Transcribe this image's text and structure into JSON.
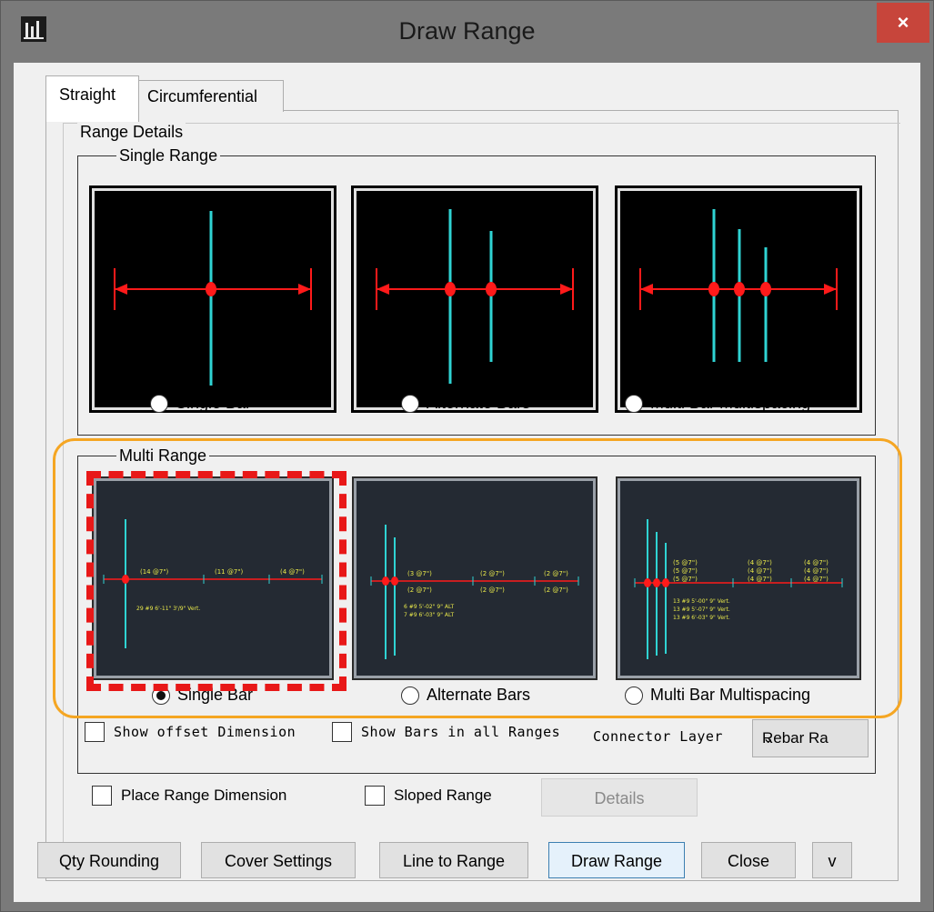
{
  "window": {
    "title": "Draw Range",
    "close_label": "×"
  },
  "tabs": {
    "straight": "Straight",
    "circumferential": "Circumferential"
  },
  "range_details": {
    "label": "Range Details",
    "single_range": {
      "label": "Single Range",
      "options": [
        "Single Bar",
        "Alternate Bars",
        "Multi Bar Multispacing"
      ]
    },
    "multi_range": {
      "label": "Multi Range",
      "options": [
        "Single Bar",
        "Alternate Bars",
        "Multi Bar Multispacing"
      ],
      "selected": "Single Bar",
      "thumb1": {
        "labels": [
          "(14 @7\")",
          "(11 @7\")",
          "(4 @7\")"
        ],
        "note": "29 #9 6'-11\" 3'/9\" Vert."
      },
      "thumb2": {
        "labels_top": [
          "(3 @7\")",
          "(2 @7\")",
          "(2 @7\")"
        ],
        "labels_bot": [
          "(2 @7\")",
          "(2 @7\")",
          "(2 @7\")"
        ],
        "notes": [
          "6 #9 5'-02\" 9\" ALT",
          "7 #9 6'-03\" 9\" ALT"
        ]
      },
      "thumb3": {
        "col1": [
          "(5 @7\")",
          "(5 @7\")",
          "(5 @7\")"
        ],
        "col2": [
          "(4 @7\")",
          "(4 @7\")",
          "(4 @7\")"
        ],
        "col3": [
          "(4 @7\")",
          "(4 @7\")",
          "(4 @7\")"
        ],
        "notes": [
          "13 #9 5'-00\" 9\" Vert.",
          "13 #9 5'-07\" 9\" Vert.",
          "13 #9 6'-03\" 9\" Vert."
        ]
      }
    },
    "show_offset_dimension": "Show offset Dimension",
    "show_bars_in_all_ranges": "Show Bars in all Ranges",
    "connector_layer_label": "Connector Layer",
    "connector_layer_value": "Rebar Ra",
    "place_range_dimension": "Place Range Dimension",
    "sloped_range": "Sloped Range",
    "details_button": "Details"
  },
  "buttons": {
    "qty_rounding": "Qty Rounding",
    "cover_settings": "Cover Settings",
    "line_to_range": "Line to Range",
    "draw_range": "Draw Range",
    "close": "Close",
    "more": "v"
  },
  "colors": {
    "bar": "#2fd3d3",
    "dimension": "#ff1a1a",
    "annotation": "#e8e84a",
    "highlight": "#f5a623",
    "title_bar": "#7a7a7a",
    "close": "#c7453b"
  }
}
